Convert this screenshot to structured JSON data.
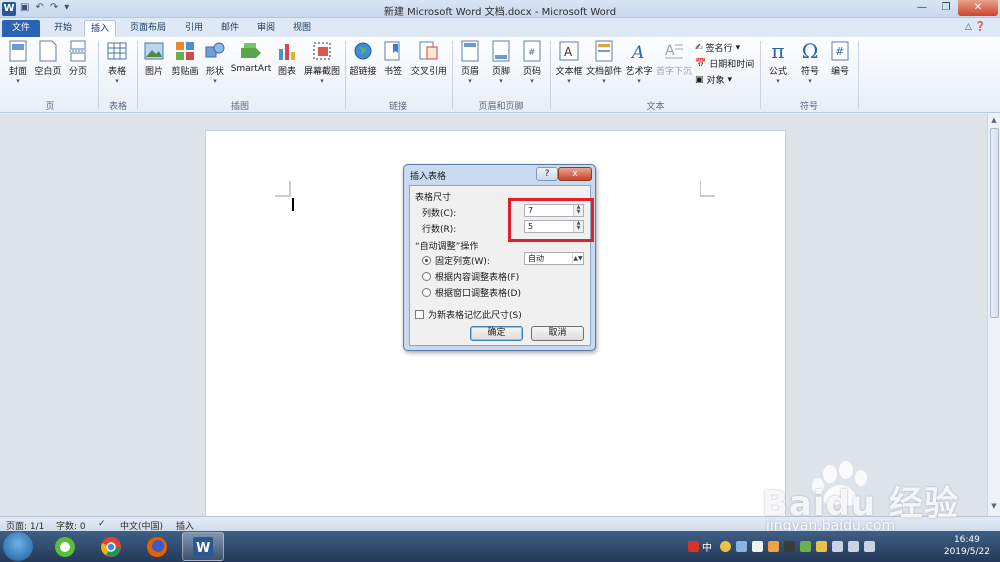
{
  "window": {
    "title": "新建 Microsoft Word 文档.docx - Microsoft Word",
    "app_icon": "W",
    "controls": [
      "minimize-icon",
      "maximize-icon",
      "close-icon"
    ]
  },
  "tabs": [
    "文件",
    "开始",
    "插入",
    "页面布局",
    "引用",
    "邮件",
    "审阅",
    "视图"
  ],
  "ribbon": {
    "pages": {
      "label": "页",
      "items": [
        "封面",
        "空白页",
        "分页"
      ]
    },
    "tables": {
      "label": "表格",
      "items": [
        "表格"
      ]
    },
    "illustrations": {
      "label": "插图",
      "items": [
        "图片",
        "剪贴画",
        "形状",
        "SmartArt",
        "图表",
        "屏幕截图"
      ]
    },
    "links": {
      "label": "链接",
      "items": [
        "超链接",
        "书签",
        "交叉引用"
      ]
    },
    "header_footer": {
      "label": "页眉和页脚",
      "items": [
        "页眉",
        "页脚",
        "页码"
      ]
    },
    "text": {
      "label": "文本",
      "items": [
        "文本框",
        "文档部件",
        "艺术字",
        "首字下沉"
      ],
      "side": [
        "签名行",
        "日期和时间",
        "对象"
      ]
    },
    "symbols": {
      "label": "符号",
      "items": [
        "公式",
        "符号",
        "编号"
      ]
    }
  },
  "dialog": {
    "title": "插入表格",
    "help": "?",
    "close": "x",
    "size_section": "表格尺寸",
    "columns_label": "列数(C):",
    "columns_value": "7",
    "rows_label": "行数(R):",
    "rows_value": "5",
    "autofit_section": "“自动调整”操作",
    "fixed_width_label": "固定列宽(W):",
    "fixed_width_value": "自动",
    "autofit_contents_label": "根据内容调整表格(F)",
    "autofit_window_label": "根据窗口调整表格(D)",
    "remember_label": "为新表格记忆此尺寸(S)",
    "ok": "确定",
    "cancel": "取消"
  },
  "status": {
    "page": "页面: 1/1",
    "words": "字数: 0",
    "language": "中文(中国)",
    "mode": "插入"
  },
  "watermark": {
    "brand": "Baidu 经验",
    "url": "jingyan.baidu.com"
  },
  "taskbar": {
    "time": "16:49",
    "date": "2019/5/22",
    "ime": "中"
  },
  "colors": {
    "highlight": "#e0202a",
    "file_tab": "#2a63b1"
  }
}
